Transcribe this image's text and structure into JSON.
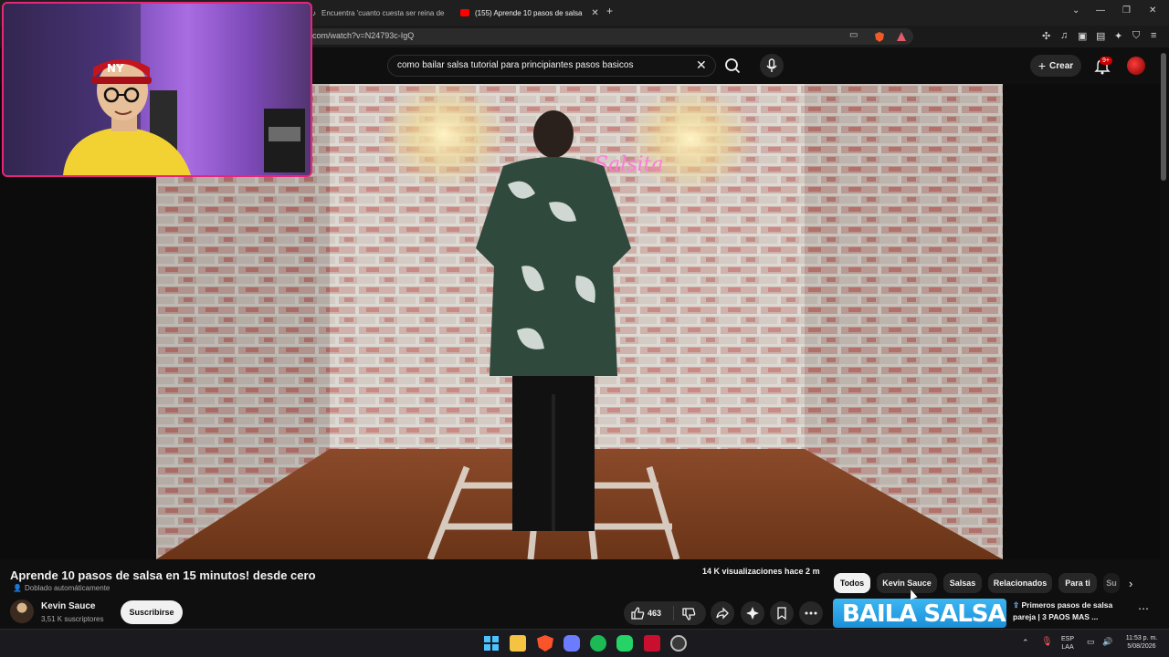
{
  "browser": {
    "tabs": [
      {
        "label": "Encuentra 'cuanto cuesta ser reina de",
        "active": false
      },
      {
        "label": "(155) Aprende 10 pasos de salsa",
        "active": true
      }
    ],
    "url": "com/watch?v=N24793c-IgQ"
  },
  "header": {
    "search_query": "como bailar salsa tutorial para principiantes pasos basicos",
    "create_label": "Crear",
    "notifications_badge": "9+"
  },
  "video": {
    "title": "Aprende 10 pasos de salsa en 15 minutos! desde cero",
    "dubbed_label": "Doblado automáticamente",
    "views_line": "14 K visualizaciones  hace 2 m",
    "like_count": "463",
    "neon_sign": "Salsita"
  },
  "channel": {
    "name": "Kevin Sauce",
    "subscribers": "3,51 K suscriptores",
    "subscribe_label": "Suscribirse"
  },
  "chips": [
    {
      "label": "Todos",
      "active": true
    },
    {
      "label": "Kevin Sauce",
      "active": false
    },
    {
      "label": "Salsas",
      "active": false
    },
    {
      "label": "Relacionados",
      "active": false
    },
    {
      "label": "Para ti",
      "active": false
    },
    {
      "label": "Su",
      "active": false
    }
  ],
  "recommended": {
    "thumb_text": "BAILA SALSA",
    "title": "Primeros pasos de salsa pareja | 3 PAOS MAS ..."
  },
  "taskbar": {
    "language": "ESP",
    "language_sub": "LAA",
    "time": "11:53 p. m.",
    "date": "5/08/2026"
  },
  "colors": {
    "accent": "#cc0000",
    "webcam_border": "#e8257c",
    "background": "#0f0f0f"
  }
}
